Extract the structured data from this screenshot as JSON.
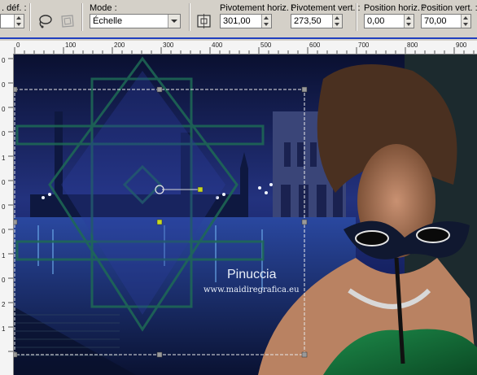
{
  "toolbar": {
    "ref_label": ". déf. :",
    "mode_label": "Mode :",
    "mode_value": "Échelle",
    "pivot_h_label": "Pivotement horiz. :",
    "pivot_h_value": "301,00",
    "pivot_v_label": "Pivotement vert. :",
    "pivot_v_value": "273,50",
    "pos_h_label": "Position horiz. :",
    "pos_h_value": "0,00",
    "pos_v_label": "Position vert. :",
    "pos_v_value": "70,00"
  },
  "ruler_top": [
    "0",
    "100",
    "200",
    "300",
    "400",
    "500",
    "600",
    "700",
    "800",
    "900"
  ],
  "ruler_left": [
    "0",
    "0",
    "0",
    "0",
    "1",
    "0",
    "0",
    "0",
    "1",
    "0",
    "2",
    "1"
  ],
  "watermark": {
    "name": "Pinuccia",
    "url": "www.maidiregrafica.eu"
  },
  "colors": {
    "selection_handle": "#c8d820",
    "accent_blue": "#1f3fbf"
  }
}
